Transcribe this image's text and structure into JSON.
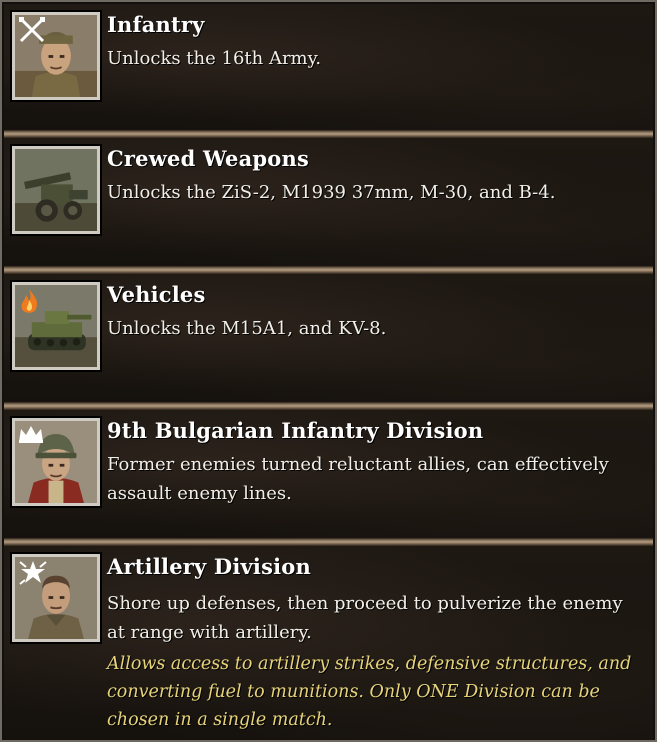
{
  "items": [
    {
      "title": "Infantry",
      "description": "Unlocks the 16th Army.",
      "icon": "soldier-portrait-icon",
      "badge": "crossed-rifles-icon"
    },
    {
      "title": "Crewed Weapons",
      "description": "Unlocks the ZiS-2, M1939 37mm, M-30, and B-4.",
      "icon": "artillery-gun-icon"
    },
    {
      "title": "Vehicles",
      "description": "Unlocks the M15A1, and KV-8.",
      "icon": "tank-icon",
      "badge": "flame-icon"
    },
    {
      "title": "9th Bulgarian Infantry Division",
      "description": "Former enemies turned reluctant allies, can effectively assault enemy lines.",
      "icon": "bulgarian-soldier-portrait-icon",
      "badge": "crown-icon"
    },
    {
      "title": "Artillery Division",
      "description": "Shore up defenses, then proceed to pulverize the enemy at range with artillery.",
      "note": "Allows access to artillery strikes, defensive structures, and converting fuel to munitions. Only ONE Division can be chosen in a single match.",
      "icon": "officer-portrait-icon",
      "badge": "star-burst-icon"
    }
  ],
  "colors": {
    "title": "#ffffff",
    "description": "#f2efe9",
    "note": "#e6d37a",
    "divider": "#b39c80",
    "frame": "#cfcac2"
  }
}
